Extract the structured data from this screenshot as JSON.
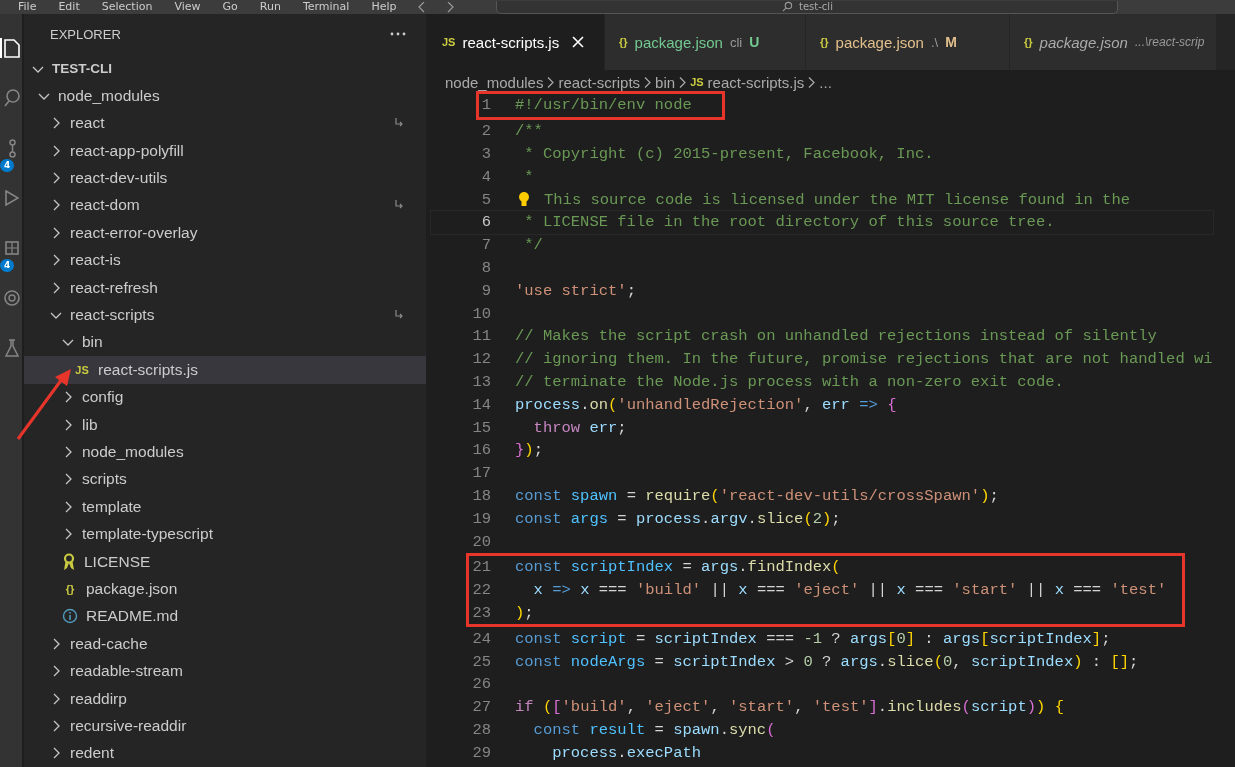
{
  "menu_bar": {
    "items": [
      "File",
      "Edit",
      "Selection",
      "View",
      "Go",
      "Run",
      "Terminal",
      "Help"
    ],
    "search": {
      "value": "test-cli"
    }
  },
  "activity_bar": [
    {
      "kind": "files",
      "selected": true
    },
    {
      "kind": "search",
      "selected": false
    },
    {
      "kind": "scm",
      "selected": false,
      "badge": "4"
    },
    {
      "kind": "run",
      "selected": false
    },
    {
      "kind": "extensions",
      "selected": false,
      "badge": "4"
    },
    {
      "kind": "remote",
      "selected": false
    },
    {
      "kind": "testing",
      "selected": false
    }
  ],
  "sidebar": {
    "title": "EXPLORER",
    "tree": [
      {
        "label": "TEST-CLI",
        "kind": "root",
        "expanded": true,
        "children": [
          {
            "label": "node_modules",
            "kind": "folder",
            "expanded": true,
            "children": [
              {
                "label": "react",
                "kind": "folder",
                "expanded": false,
                "symlink": true
              },
              {
                "label": "react-app-polyfill",
                "kind": "folder",
                "expanded": false
              },
              {
                "label": "react-dev-utils",
                "kind": "folder",
                "expanded": false
              },
              {
                "label": "react-dom",
                "kind": "folder",
                "expanded": false,
                "symlink": true
              },
              {
                "label": "react-error-overlay",
                "kind": "folder",
                "expanded": false
              },
              {
                "label": "react-is",
                "kind": "folder",
                "expanded": false
              },
              {
                "label": "react-refresh",
                "kind": "folder",
                "expanded": false
              },
              {
                "label": "react-scripts",
                "kind": "folder",
                "expanded": true,
                "symlink": true,
                "children": [
                  {
                    "label": "bin",
                    "kind": "folder",
                    "expanded": true,
                    "children": [
                      {
                        "label": "react-scripts.js",
                        "kind": "file",
                        "icon_text": "JS",
                        "selected": true,
                        "pointer": true
                      }
                    ]
                  },
                  {
                    "label": "config",
                    "kind": "folder",
                    "expanded": false
                  },
                  {
                    "label": "lib",
                    "kind": "folder",
                    "expanded": false
                  },
                  {
                    "label": "node_modules",
                    "kind": "folder",
                    "expanded": false
                  },
                  {
                    "label": "scripts",
                    "kind": "folder",
                    "expanded": false
                  },
                  {
                    "label": "template",
                    "kind": "folder",
                    "expanded": false
                  },
                  {
                    "label": "template-typescript",
                    "kind": "folder",
                    "expanded": false
                  },
                  {
                    "label": "LICENSE",
                    "kind": "license",
                    "selected": false
                  },
                  {
                    "label": "package.json",
                    "kind": "file",
                    "icon_text": "{}",
                    "selected": false
                  },
                  {
                    "label": "README.md",
                    "kind": "info",
                    "selected": false
                  }
                ]
              },
              {
                "label": "read-cache",
                "kind": "folder",
                "expanded": false
              },
              {
                "label": "readable-stream",
                "kind": "folder",
                "expanded": false
              },
              {
                "label": "readdirp",
                "kind": "folder",
                "expanded": false
              },
              {
                "label": "recursive-readdir",
                "kind": "folder",
                "expanded": false
              },
              {
                "label": "redent",
                "kind": "folder",
                "expanded": false
              }
            ]
          }
        ]
      }
    ]
  },
  "tabs": [
    {
      "label": "react-scripts.js",
      "icon_text": "JS",
      "selected": true,
      "preview": false
    },
    {
      "label": "package.json",
      "icon_text": "{}",
      "selected": false,
      "preview": false,
      "description": "cli",
      "color": "#73c991",
      "status_letter": "U"
    },
    {
      "label": "package.json",
      "icon_text": "{}",
      "selected": false,
      "preview": false,
      "description": ".\\",
      "color": "#e2c08d",
      "status_letter": "M"
    },
    {
      "label": "package.json",
      "icon_text": "{}",
      "selected": false,
      "preview": true,
      "description": "...\\react-scrip"
    }
  ],
  "breadcrumbs": [
    {
      "label": "node_modules"
    },
    {
      "label": "react-scripts"
    },
    {
      "label": "bin"
    },
    {
      "label": "react-scripts.js",
      "icon_text": "JS"
    },
    {
      "label": "..."
    }
  ],
  "code": [
    {
      "kind": "boxed",
      "lines": [
        {
          "number": "1",
          "tokens": [
            {
              "kind": "comment",
              "text": "#!/usr/bin/env node"
            }
          ]
        }
      ]
    },
    {
      "kind": "plain",
      "lines": [
        {
          "number": "2",
          "tokens": [
            {
              "kind": "comment",
              "text": "/**"
            }
          ]
        },
        {
          "number": "3",
          "tokens": [
            {
              "kind": "comment",
              "text": " * Copyright (c) 2015-present, Facebook, Inc."
            }
          ]
        },
        {
          "number": "4",
          "tokens": [
            {
              "kind": "comment",
              "text": " *"
            }
          ]
        },
        {
          "number": "5",
          "lightbulb": true,
          "tokens": [
            {
              "kind": "comment",
              "text": "This source code is licensed under the MIT license found in the"
            }
          ]
        },
        {
          "number": "6",
          "current": true,
          "tokens": [
            {
              "kind": "comment",
              "text": " * LICENSE file in the root directory of this source tree."
            }
          ]
        },
        {
          "number": "7",
          "tokens": [
            {
              "kind": "comment",
              "text": " */"
            }
          ]
        },
        {
          "number": "8"
        },
        {
          "number": "9",
          "tokens": [
            {
              "kind": "string",
              "text": "'use strict'"
            },
            {
              "kind": "operator",
              "text": ";"
            }
          ]
        },
        {
          "number": "10"
        },
        {
          "number": "11",
          "tokens": [
            {
              "kind": "comment",
              "text": "// Makes the script crash on unhandled rejections instead of silently"
            }
          ]
        },
        {
          "number": "12",
          "tokens": [
            {
              "kind": "comment",
              "text": "// ignoring them. In the future, promise rejections that are not handled wi"
            }
          ]
        },
        {
          "number": "13",
          "tokens": [
            {
              "kind": "comment",
              "text": "// terminate the Node.js process with a non-zero exit code."
            }
          ]
        },
        {
          "number": "14",
          "tokens": [
            {
              "kind": "variable",
              "text": "process"
            },
            {
              "kind": "operator",
              "text": "."
            },
            {
              "kind": "function",
              "text": "on"
            },
            {
              "kind": "bracket1",
              "text": "("
            },
            {
              "kind": "string",
              "text": "'unhandledRejection'"
            },
            {
              "kind": "operator",
              "text": ", "
            },
            {
              "kind": "variable",
              "text": "err"
            },
            {
              "kind": "keyword",
              "text": " => "
            },
            {
              "kind": "bracket2",
              "text": "{"
            }
          ]
        },
        {
          "number": "15",
          "tokens": [
            {
              "kind": "control",
              "text": "  throw "
            },
            {
              "kind": "variable",
              "text": "err"
            },
            {
              "kind": "operator",
              "text": ";"
            }
          ]
        },
        {
          "number": "16",
          "tokens": [
            {
              "kind": "bracket2",
              "text": "}"
            },
            {
              "kind": "bracket1",
              "text": ")"
            },
            {
              "kind": "operator",
              "text": ";"
            }
          ]
        },
        {
          "number": "17"
        },
        {
          "number": "18",
          "tokens": [
            {
              "kind": "keyword",
              "text": "const "
            },
            {
              "kind": "constant",
              "text": "spawn"
            },
            {
              "kind": "operator",
              "text": " = "
            },
            {
              "kind": "function",
              "text": "require"
            },
            {
              "kind": "bracket1",
              "text": "("
            },
            {
              "kind": "string",
              "text": "'react-dev-utils/crossSpawn'"
            },
            {
              "kind": "bracket1",
              "text": ")"
            },
            {
              "kind": "operator",
              "text": ";"
            }
          ]
        },
        {
          "number": "19",
          "tokens": [
            {
              "kind": "keyword",
              "text": "const "
            },
            {
              "kind": "constant",
              "text": "args"
            },
            {
              "kind": "operator",
              "text": " = "
            },
            {
              "kind": "variable",
              "text": "process"
            },
            {
              "kind": "operator",
              "text": "."
            },
            {
              "kind": "variable",
              "text": "argv"
            },
            {
              "kind": "operator",
              "text": "."
            },
            {
              "kind": "function",
              "text": "slice"
            },
            {
              "kind": "bracket1",
              "text": "("
            },
            {
              "kind": "number",
              "text": "2"
            },
            {
              "kind": "bracket1",
              "text": ")"
            },
            {
              "kind": "operator",
              "text": ";"
            }
          ]
        },
        {
          "number": "20"
        }
      ]
    },
    {
      "kind": "boxed",
      "lines": [
        {
          "number": "21",
          "tokens": [
            {
              "kind": "keyword",
              "text": "const "
            },
            {
              "kind": "constant",
              "text": "scriptIndex"
            },
            {
              "kind": "operator",
              "text": " = "
            },
            {
              "kind": "variable",
              "text": "args"
            },
            {
              "kind": "operator",
              "text": "."
            },
            {
              "kind": "function",
              "text": "findIndex"
            },
            {
              "kind": "bracket1",
              "text": "("
            }
          ]
        },
        {
          "number": "22",
          "tokens": [
            {
              "kind": "variable",
              "text": "  x"
            },
            {
              "kind": "keyword",
              "text": " => "
            },
            {
              "kind": "variable",
              "text": "x"
            },
            {
              "kind": "operator",
              "text": " === "
            },
            {
              "kind": "string",
              "text": "'build'"
            },
            {
              "kind": "operator",
              "text": " || "
            },
            {
              "kind": "variable",
              "text": "x"
            },
            {
              "kind": "operator",
              "text": " === "
            },
            {
              "kind": "string",
              "text": "'eject'"
            },
            {
              "kind": "operator",
              "text": " || "
            },
            {
              "kind": "variable",
              "text": "x"
            },
            {
              "kind": "operator",
              "text": " === "
            },
            {
              "kind": "string",
              "text": "'start'"
            },
            {
              "kind": "operator",
              "text": " || "
            },
            {
              "kind": "variable",
              "text": "x"
            },
            {
              "kind": "operator",
              "text": " === "
            },
            {
              "kind": "string",
              "text": "'test'"
            }
          ]
        },
        {
          "number": "23",
          "tokens": [
            {
              "kind": "bracket1",
              "text": ")"
            },
            {
              "kind": "operator",
              "text": ";"
            }
          ]
        }
      ]
    },
    {
      "kind": "plain",
      "lines": [
        {
          "number": "24",
          "tokens": [
            {
              "kind": "keyword",
              "text": "const "
            },
            {
              "kind": "constant",
              "text": "script"
            },
            {
              "kind": "operator",
              "text": " = "
            },
            {
              "kind": "variable",
              "text": "scriptIndex"
            },
            {
              "kind": "operator",
              "text": " === "
            },
            {
              "kind": "number",
              "text": "-1"
            },
            {
              "kind": "operator",
              "text": " ? "
            },
            {
              "kind": "variable",
              "text": "args"
            },
            {
              "kind": "bracket1",
              "text": "["
            },
            {
              "kind": "number",
              "text": "0"
            },
            {
              "kind": "bracket1",
              "text": "]"
            },
            {
              "kind": "operator",
              "text": " : "
            },
            {
              "kind": "variable",
              "text": "args"
            },
            {
              "kind": "bracket1",
              "text": "["
            },
            {
              "kind": "variable",
              "text": "scriptIndex"
            },
            {
              "kind": "bracket1",
              "text": "]"
            },
            {
              "kind": "operator",
              "text": ";"
            }
          ]
        },
        {
          "number": "25",
          "tokens": [
            {
              "kind": "keyword",
              "text": "const "
            },
            {
              "kind": "constant",
              "text": "nodeArgs"
            },
            {
              "kind": "operator",
              "text": " = "
            },
            {
              "kind": "variable",
              "text": "scriptIndex"
            },
            {
              "kind": "operator",
              "text": " > "
            },
            {
              "kind": "number",
              "text": "0"
            },
            {
              "kind": "operator",
              "text": " ? "
            },
            {
              "kind": "variable",
              "text": "args"
            },
            {
              "kind": "operator",
              "text": "."
            },
            {
              "kind": "function",
              "text": "slice"
            },
            {
              "kind": "bracket1",
              "text": "("
            },
            {
              "kind": "number",
              "text": "0"
            },
            {
              "kind": "operator",
              "text": ", "
            },
            {
              "kind": "variable",
              "text": "scriptIndex"
            },
            {
              "kind": "bracket1",
              "text": ")"
            },
            {
              "kind": "operator",
              "text": " : "
            },
            {
              "kind": "bracket1",
              "text": "[]"
            },
            {
              "kind": "operator",
              "text": ";"
            }
          ]
        },
        {
          "number": "26"
        },
        {
          "number": "27",
          "tokens": [
            {
              "kind": "control",
              "text": "if "
            },
            {
              "kind": "bracket1",
              "text": "("
            },
            {
              "kind": "bracket2",
              "text": "["
            },
            {
              "kind": "string",
              "text": "'build'"
            },
            {
              "kind": "operator",
              "text": ", "
            },
            {
              "kind": "string",
              "text": "'eject'"
            },
            {
              "kind": "operator",
              "text": ", "
            },
            {
              "kind": "string",
              "text": "'start'"
            },
            {
              "kind": "operator",
              "text": ", "
            },
            {
              "kind": "string",
              "text": "'test'"
            },
            {
              "kind": "bracket2",
              "text": "]"
            },
            {
              "kind": "operator",
              "text": "."
            },
            {
              "kind": "function",
              "text": "includes"
            },
            {
              "kind": "bracket2",
              "text": "("
            },
            {
              "kind": "variable",
              "text": "script"
            },
            {
              "kind": "bracket2",
              "text": ")"
            },
            {
              "kind": "bracket1",
              "text": ") {"
            }
          ]
        },
        {
          "number": "28",
          "tokens": [
            {
              "kind": "keyword",
              "text": "  const "
            },
            {
              "kind": "constant",
              "text": "result"
            },
            {
              "kind": "operator",
              "text": " = "
            },
            {
              "kind": "variable",
              "text": "spawn"
            },
            {
              "kind": "operator",
              "text": "."
            },
            {
              "kind": "function",
              "text": "sync"
            },
            {
              "kind": "bracket2",
              "text": "("
            }
          ]
        },
        {
          "number": "29",
          "tokens": [
            {
              "kind": "variable",
              "text": "    process"
            },
            {
              "kind": "operator",
              "text": "."
            },
            {
              "kind": "variable",
              "text": "execPath"
            }
          ]
        }
      ]
    }
  ]
}
